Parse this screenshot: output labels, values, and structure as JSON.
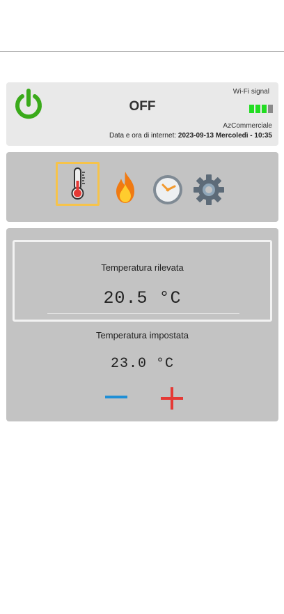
{
  "status": {
    "power_state": "OFF",
    "wifi_label": "Wi-Fi signal",
    "wifi_signal_bars": 3,
    "wifi_signal_max": 4,
    "network_name": "AzCommerciale",
    "datetime_label": "Data e ora di internet:",
    "datetime_value": "2023-09-13 Mercoledì - 10:35"
  },
  "nav": {
    "items": [
      {
        "icon": "thermometer-icon",
        "active": true
      },
      {
        "icon": "flame-icon",
        "active": false
      },
      {
        "icon": "clock-icon",
        "active": false
      },
      {
        "icon": "gear-icon",
        "active": false
      }
    ]
  },
  "temperature": {
    "measured_label": "Temperatura rilevata",
    "measured_value": "20.5 °C",
    "set_label": "Temperatura impostata",
    "set_value": "23.0 °C"
  },
  "colors": {
    "power_green": "#3aaa1a",
    "active_highlight": "#f6c34a",
    "wifi_on": "#22dd22",
    "wifi_off": "#8a8a8a",
    "minus_blue": "#1f8fd6",
    "plus_red": "#e53935"
  }
}
